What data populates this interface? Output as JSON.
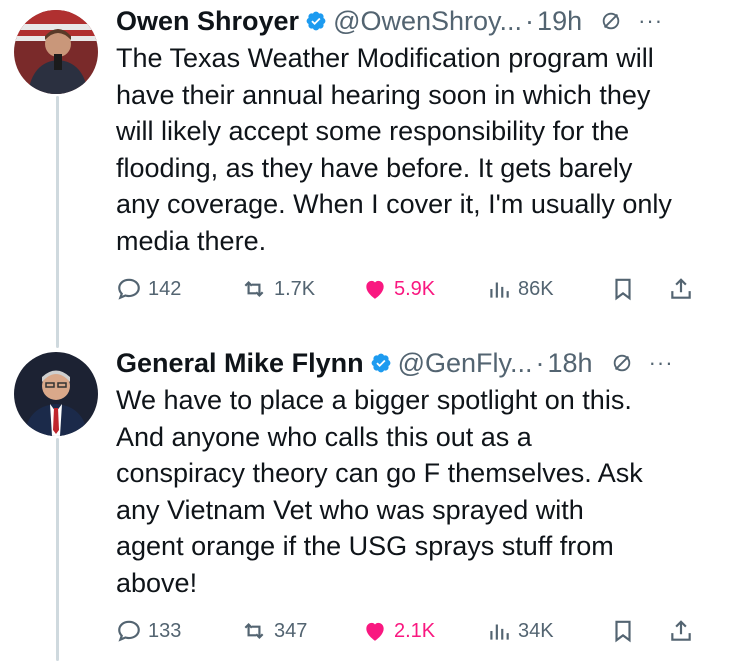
{
  "tweets": [
    {
      "display_name": "Owen Shroyer",
      "handle": "@OwenShroy...",
      "dot": "·",
      "time": "19h",
      "lines": [
        "The Texas Weather Modification program will",
        "have their annual hearing soon in which they",
        "will likely accept some responsibility for the",
        "flooding, as they have before. It gets barely",
        "any coverage. When I cover it, I'm usually only",
        "media there."
      ],
      "replies": "142",
      "reposts": "1.7K",
      "likes": "5.9K",
      "views": "86K"
    },
    {
      "display_name": "General Mike Flynn",
      "handle": "@GenFly...",
      "dot": "·",
      "time": "18h",
      "lines": [
        "We have to place a bigger spotlight on this.",
        "And anyone who calls this out as a",
        "conspiracy theory can go F themselves. Ask",
        "any Vietnam Vet who was sprayed with",
        "agent orange if the USG sprays stuff from",
        "above!"
      ],
      "replies": "133",
      "reposts": "347",
      "likes": "2.1K",
      "views": "34K"
    }
  ],
  "colors": {
    "text": "#0f1419",
    "muted": "#536471",
    "like": "#f91880",
    "verified": "#1d9bf0",
    "thread_line": "#cfd9de"
  },
  "icons": [
    "reply-icon",
    "repost-icon",
    "like-icon",
    "views-icon",
    "bookmark-icon",
    "share-icon",
    "verified-icon",
    "grok-icon",
    "more-icon"
  ]
}
